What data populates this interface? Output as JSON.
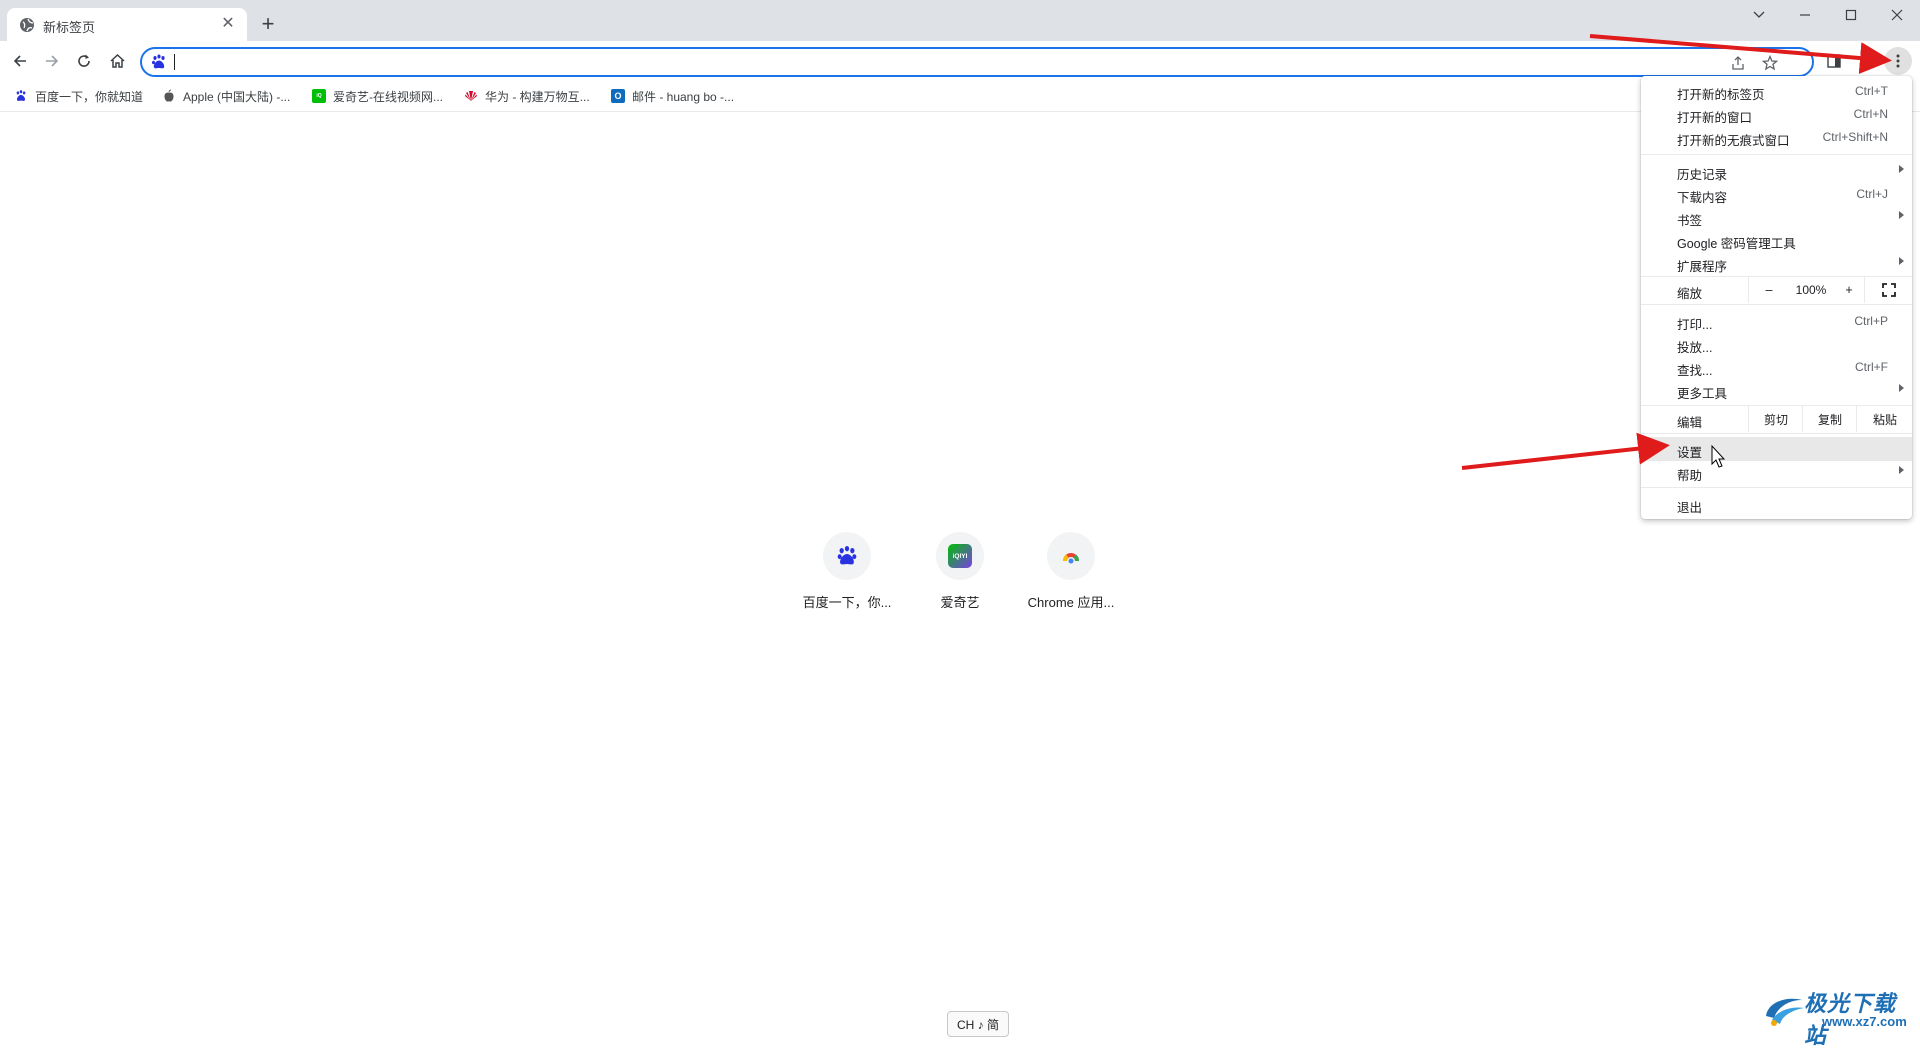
{
  "tab": {
    "title": "新标签页",
    "close": "✕"
  },
  "new_tab": "+",
  "window_controls": {
    "dropdown": "⌄",
    "minimize": "—",
    "maximize": "☐",
    "close": "✕"
  },
  "omnibox": {
    "value": ""
  },
  "bookmarks": [
    {
      "label": "百度一下，你就知道",
      "icon": "baidu-icon",
      "color": "#2932e1"
    },
    {
      "label": "Apple (中国大陆) -...",
      "icon": "apple-icon",
      "color": "#555555"
    },
    {
      "label": "爱奇艺-在线视频网...",
      "icon": "iqiyi-icon",
      "color": "#00be06"
    },
    {
      "label": "华为 - 构建万物互...",
      "icon": "huawei-icon",
      "color": "#cf0a2c"
    },
    {
      "label": "邮件 - huang bo -...",
      "icon": "outlook-icon",
      "color": "#0f6cbd"
    }
  ],
  "shortcuts": [
    {
      "label": "百度一下，你...",
      "icon": "baidu-icon"
    },
    {
      "label": "爱奇艺",
      "icon": "iqiyi-icon",
      "icon_text": "iQIYI"
    },
    {
      "label": "Chrome 应用...",
      "icon": "chrome-apps-icon"
    }
  ],
  "menu": {
    "new_tab": {
      "label": "打开新的标签页",
      "shortcut": "Ctrl+T"
    },
    "new_window": {
      "label": "打开新的窗口",
      "shortcut": "Ctrl+N"
    },
    "incognito": {
      "label": "打开新的无痕式窗口",
      "shortcut": "Ctrl+Shift+N"
    },
    "history": {
      "label": "历史记录"
    },
    "downloads": {
      "label": "下载内容",
      "shortcut": "Ctrl+J"
    },
    "bookmarks": {
      "label": "书签"
    },
    "passwords": {
      "label": "Google 密码管理工具"
    },
    "extensions": {
      "label": "扩展程序"
    },
    "zoom": {
      "label": "缩放",
      "minus": "–",
      "value": "100%",
      "plus": "+"
    },
    "print": {
      "label": "打印...",
      "shortcut": "Ctrl+P"
    },
    "cast": {
      "label": "投放..."
    },
    "find": {
      "label": "查找...",
      "shortcut": "Ctrl+F"
    },
    "more_tools": {
      "label": "更多工具"
    },
    "edit": {
      "label": "编辑",
      "cut": "剪切",
      "copy": "复制",
      "paste": "粘贴"
    },
    "settings": {
      "label": "设置"
    },
    "help": {
      "label": "帮助"
    },
    "exit": {
      "label": "退出"
    }
  },
  "ime": "CH ♪ 简",
  "watermark": {
    "title": "极光下载站",
    "url": "www.xz7.com"
  },
  "colors": {
    "accent": "#1a73e8",
    "annotation_arrow": "#e01b1b"
  }
}
